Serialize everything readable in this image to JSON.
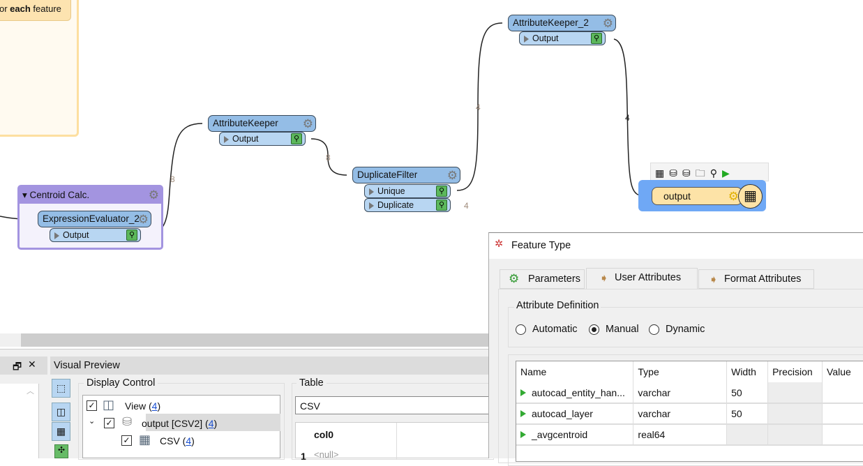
{
  "canvas": {
    "note": {
      "text_prefix": "or ",
      "text_bold": "each",
      "text_suffix": " feature"
    },
    "group": {
      "title": "Centroid Calc."
    },
    "transformers": [
      {
        "name": "ExpressionEvaluator_2",
        "ports": [
          "Output"
        ]
      },
      {
        "name": "AttributeKeeper",
        "ports": [
          "Output"
        ]
      },
      {
        "name": "DuplicateFilter",
        "ports": [
          "Unique",
          "Duplicate"
        ]
      },
      {
        "name": "AttributeKeeper_2",
        "ports": [
          "Output"
        ]
      }
    ],
    "writer": {
      "name": "output"
    },
    "feature_counts": {
      "expr_to_keeper": "8",
      "keeper_to_filter": "8",
      "unique_to_keeper2": "4",
      "duplicate": "4",
      "keeper2_to_output": "4"
    }
  },
  "bottom": {
    "visual_preview_title": "Visual Preview",
    "display_control": {
      "title": "Display Control",
      "items": [
        {
          "label": "View (",
          "count": "4",
          "close": ")",
          "checked": true
        },
        {
          "label": "output [CSV2] (",
          "count": "4",
          "close": ")",
          "checked": true
        },
        {
          "label": "CSV (",
          "count": "4",
          "close": ")",
          "checked": true
        }
      ]
    },
    "table": {
      "title": "Table",
      "selected": "CSV",
      "column": "col0",
      "row_number": "1",
      "cell": "<null>"
    }
  },
  "dialog": {
    "title": "Feature Type",
    "tabs": [
      "Parameters",
      "User Attributes",
      "Format Attributes"
    ],
    "active_tab": "User Attributes",
    "attribute_definition": {
      "legend": "Attribute Definition",
      "options": [
        "Automatic",
        "Manual",
        "Dynamic"
      ],
      "selected": "Manual"
    },
    "attributes": {
      "columns": [
        "Name",
        "Type",
        "Width",
        "Precision",
        "Value"
      ],
      "rows": [
        {
          "name": "autocad_entity_han...",
          "type": "varchar",
          "width": "50",
          "precision": "",
          "value": ""
        },
        {
          "name": "autocad_layer",
          "type": "varchar",
          "width": "50",
          "precision": "",
          "value": ""
        },
        {
          "name": "_avgcentroid",
          "type": "real64",
          "width": "",
          "precision": "",
          "value": ""
        }
      ]
    }
  },
  "colors": {
    "transformer": "#94bde6",
    "group": "#a394e0",
    "writer": "#fde3a7",
    "selection": "#6fa8f5"
  }
}
